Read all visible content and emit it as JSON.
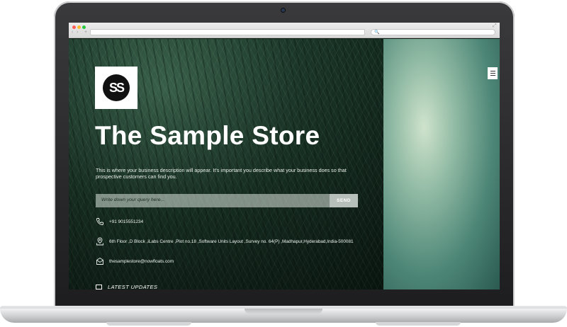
{
  "browser": {
    "search_glyph": "🔍",
    "expand_glyph": "⤢",
    "traffic_lights": [
      "#ff5f57",
      "#ffbd2e",
      "#28c840"
    ],
    "nav_back": "‹",
    "nav_forward": "›",
    "nav_reload": "+"
  },
  "site": {
    "logo_text": "SS",
    "title": "The Sample Store",
    "description": "This is where your business description will appear. It's important you describe what your business does so that prospective customers can find you.",
    "query_placeholder": "Write down your query here...",
    "send_label": "SEND",
    "phone": "+91 9015551234",
    "address": "6th Floor ,D Block ,iLabs Centre ,Plot no.18 ,Software Units Layout ,Survey no. 64(P) ,Madhapur,Hyderabad,India-500081",
    "email": "thesamplestore@nowfloats.com",
    "updates_label": "LATEST UPDATES",
    "menu_icon": "hamburger-icon"
  },
  "colors": {
    "hero_green": "#1d3a2b",
    "side_green": "#4c8576",
    "send_button": "#b6bfb9"
  }
}
